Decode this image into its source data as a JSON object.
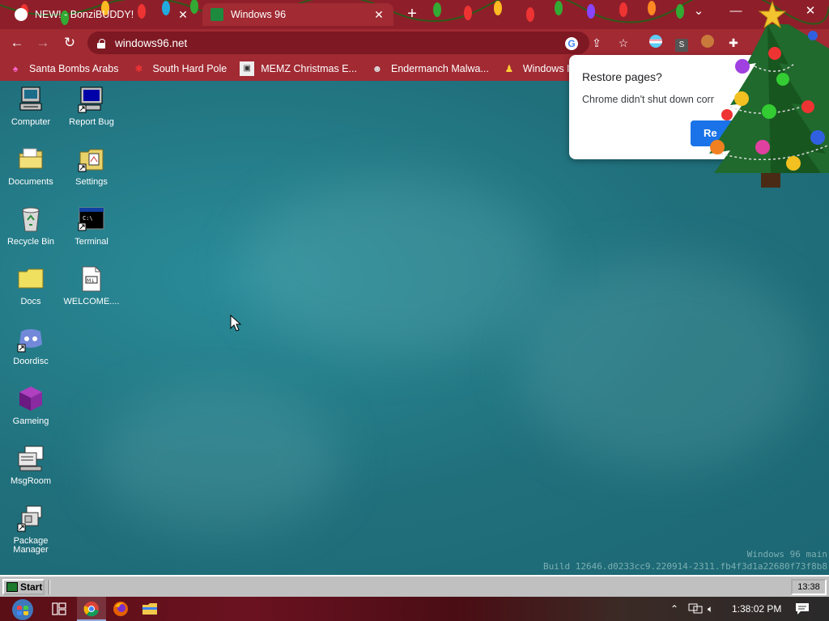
{
  "browser": {
    "tabs": [
      {
        "label": "NEW! - BonziBUDDY!",
        "active": false
      },
      {
        "label": "Windows 96",
        "active": true
      }
    ],
    "address": "windows96.net",
    "bookmarks": [
      {
        "label": "Santa Bombs Arabs",
        "icon": "santa-icon"
      },
      {
        "label": "South Hard Pole",
        "icon": "snowflake-icon"
      },
      {
        "label": "MEMZ Christmas E...",
        "icon": "memz-icon"
      },
      {
        "label": "Endermanch Malwa...",
        "icon": "endermanch-icon"
      },
      {
        "label": "Windows ISOs",
        "icon": "windows-iso-icon"
      }
    ],
    "accent": "#a12a33"
  },
  "restore_popup": {
    "title": "Restore pages?",
    "message": "Chrome didn't shut down corr",
    "button": "Re"
  },
  "desktop": {
    "icons": [
      {
        "label": "Computer",
        "icon": "computer-icon"
      },
      {
        "label": "Report Bug",
        "icon": "report-bug-icon"
      },
      {
        "label": "Documents",
        "icon": "documents-folder-icon"
      },
      {
        "label": "Settings",
        "icon": "settings-icon"
      },
      {
        "label": "Recycle Bin",
        "icon": "recycle-bin-icon"
      },
      {
        "label": "Terminal",
        "icon": "terminal-icon"
      },
      {
        "label": "Docs",
        "icon": "docs-folder-icon"
      },
      {
        "label": "WELCOME....",
        "icon": "markdown-file-icon"
      },
      {
        "label": "Doordisc",
        "icon": "doordisc-icon"
      },
      {
        "label": "Gameing",
        "icon": "gameing-cube-icon"
      },
      {
        "label": "MsgRoom",
        "icon": "msgroom-icon"
      },
      {
        "label": "Package Manager",
        "icon": "package-manager-icon"
      }
    ],
    "build_line1": "Windows 96 main",
    "build_line2": "Build 12646.d0233cc9.220914-2311.fb4f3d1a22680f73f8b8"
  },
  "w96_taskbar": {
    "start": "Start",
    "clock": "13:38"
  },
  "w10_taskbar": {
    "time": "1:38:02 PM"
  }
}
